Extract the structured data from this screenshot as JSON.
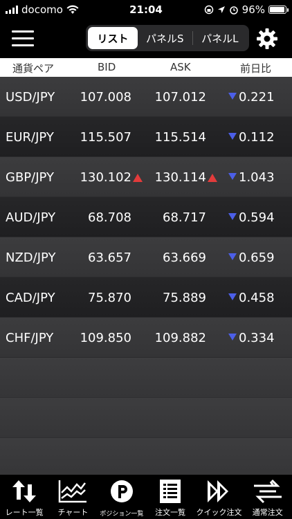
{
  "status": {
    "carrier": "docomo",
    "time": "21:04",
    "battery": "96%",
    "battery_level": 0.96
  },
  "nav": {
    "tabs": [
      {
        "label": "リスト",
        "active": true
      },
      {
        "label": "パネルS",
        "active": false
      },
      {
        "label": "パネルL",
        "active": false
      }
    ]
  },
  "table": {
    "headers": {
      "pair": "通貨ペア",
      "bid": "BID",
      "ask": "ASK",
      "change": "前日比"
    },
    "rows": [
      {
        "pair": "USD/JPY",
        "bid": "107.008",
        "ask": "107.012",
        "change": "0.221",
        "bid_up": false,
        "ask_up": false,
        "change_dir": "down"
      },
      {
        "pair": "EUR/JPY",
        "bid": "115.507",
        "ask": "115.514",
        "change": "0.112",
        "bid_up": false,
        "ask_up": false,
        "change_dir": "down"
      },
      {
        "pair": "GBP/JPY",
        "bid": "130.102",
        "ask": "130.114",
        "change": "1.043",
        "bid_up": true,
        "ask_up": true,
        "change_dir": "down"
      },
      {
        "pair": "AUD/JPY",
        "bid": "68.708",
        "ask": "68.717",
        "change": "0.594",
        "bid_up": false,
        "ask_up": false,
        "change_dir": "down"
      },
      {
        "pair": "NZD/JPY",
        "bid": "63.657",
        "ask": "63.669",
        "change": "0.659",
        "bid_up": false,
        "ask_up": false,
        "change_dir": "down"
      },
      {
        "pair": "CAD/JPY",
        "bid": "75.870",
        "ask": "75.889",
        "change": "0.458",
        "bid_up": false,
        "ask_up": false,
        "change_dir": "down"
      },
      {
        "pair": "CHF/JPY",
        "bid": "109.850",
        "ask": "109.882",
        "change": "0.334",
        "bid_up": false,
        "ask_up": false,
        "change_dir": "down"
      }
    ]
  },
  "tabbar": {
    "items": [
      {
        "label": "レート一覧",
        "icon": "rate-list-icon"
      },
      {
        "label": "チャート",
        "icon": "chart-icon"
      },
      {
        "label": "ポジション一覧",
        "icon": "position-icon"
      },
      {
        "label": "注文一覧",
        "icon": "order-list-icon"
      },
      {
        "label": "クイック注文",
        "icon": "quick-order-icon"
      },
      {
        "label": "通常注文",
        "icon": "normal-order-icon"
      }
    ]
  },
  "colors": {
    "up": "#e23b3b",
    "down": "#4c5fe8"
  }
}
